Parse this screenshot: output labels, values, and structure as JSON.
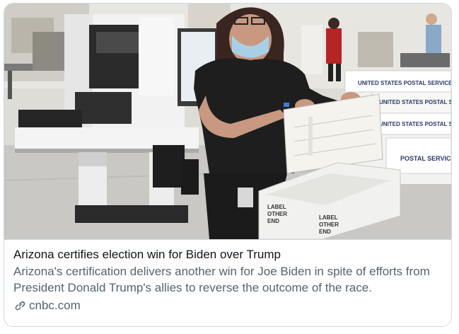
{
  "card": {
    "title": "Arizona certifies election win for Biden over Trump",
    "description": "Arizona's certification delivers another win for Joe Biden in spite of efforts from President Donald Trump's allies to reverse the outcome of the race.",
    "domain": "cnbc.com",
    "link_icon": "link-icon"
  },
  "image": {
    "box_labels": [
      "UNITED STATES POSTAL SERVICE",
      "UNITED STATES POSTAL SERVICE",
      "UNITED STATES POSTAL SERVICE",
      "POSTAL SERVICE"
    ],
    "tray_label": [
      "LABEL",
      "OTHER",
      "END"
    ],
    "tray_label_2": [
      "LABEL",
      "OTHER",
      "END"
    ]
  },
  "colors": {
    "border": "#cfd9de",
    "title": "#0f1419",
    "secondary": "#536471"
  }
}
